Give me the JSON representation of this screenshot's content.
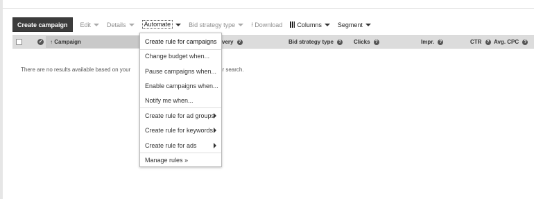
{
  "toolbar": {
    "create": "Create campaign",
    "edit": "Edit",
    "details": "Details",
    "automate": "Automate",
    "bid_strategy": "Bid strategy type",
    "download": "Download",
    "columns": "Columns",
    "segment": "Segment"
  },
  "header": {
    "campaign": "Campaign",
    "delivery": "very",
    "bid_strategy": "Bid strategy type",
    "clicks": "Clicks",
    "impr": "Impr.",
    "ctr": "CTR",
    "avg_cpc": "Avg. CPC"
  },
  "message": {
    "left": "There are no results available based on your",
    "right": "ur search."
  },
  "automate_menu": {
    "items": [
      "Create rule for campaigns",
      "Change budget when...",
      "Pause campaigns when...",
      "Enable campaigns when...",
      "Notify me when...",
      "Create rule for ad groups",
      "Create rule for keywords",
      "Create rule for ads",
      "Manage rules »"
    ]
  }
}
